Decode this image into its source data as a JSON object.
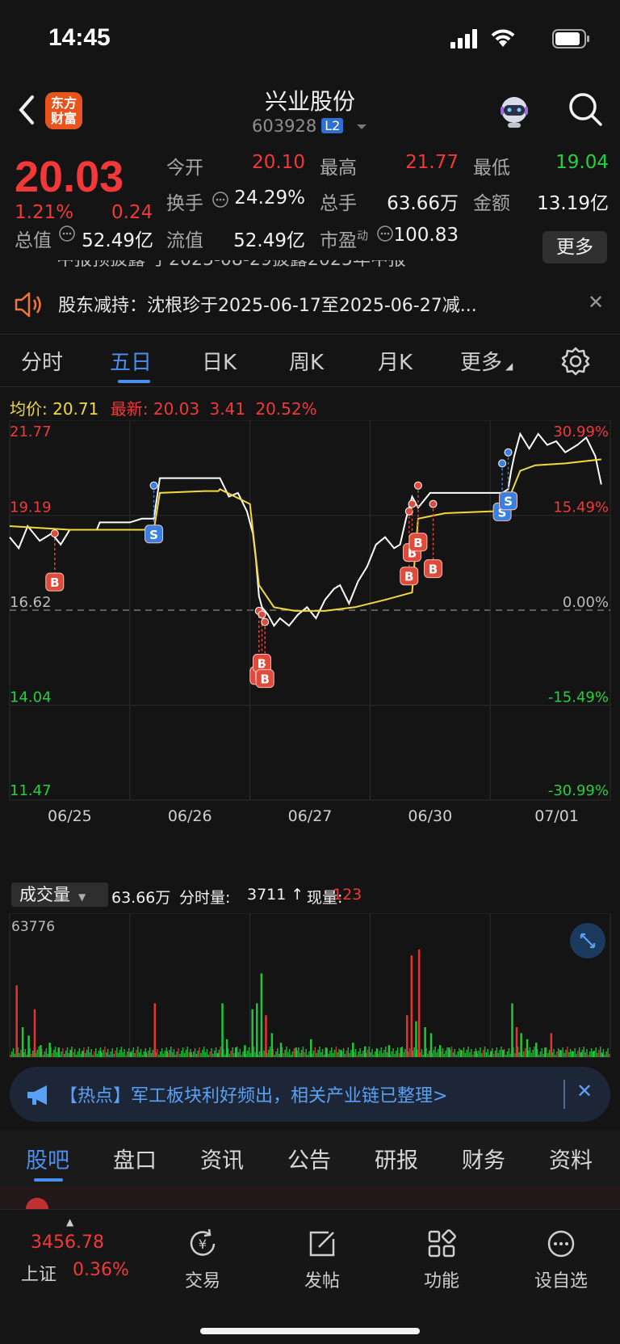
{
  "status_bar": {
    "time": "14:45"
  },
  "header": {
    "title": "兴业股份",
    "code": "603928",
    "level_badge": "L2",
    "logo_text_line1": "东方",
    "logo_text_line2": "财富"
  },
  "quote": {
    "price": "20.03",
    "change_pct": "1.21%",
    "change": "0.24",
    "fields": [
      {
        "label": "今开",
        "value": "20.10",
        "color": "#f23838"
      },
      {
        "label": "最高",
        "value": "21.77",
        "color": "#f23838"
      },
      {
        "label": "最低",
        "value": "19.04",
        "color": "#22d23c"
      },
      {
        "label": "换手",
        "value": "24.29%",
        "color": "#f2f2f2"
      },
      {
        "label": "总手",
        "value": "63.66万",
        "color": "#f2f2f2"
      },
      {
        "label": "金额",
        "value": "13.19亿",
        "color": "#f2f2f2"
      },
      {
        "label": "总值",
        "value": "52.49亿",
        "color": "#f2f2f2"
      },
      {
        "label": "流值",
        "value": "52.49亿",
        "color": "#f2f2f2"
      },
      {
        "label": "市盈",
        "value": "100.83",
        "color": "#f2f2f2"
      }
    ],
    "pe_superscript": "动",
    "more_label": "更多"
  },
  "notice": {
    "partial_text": "中报预披露 于2025-08-29披露2025年中报",
    "text": "股东减持：沈根珍于2025-06-17至2025-06-27减..."
  },
  "chart_tabs": [
    {
      "label": "分时",
      "active": false
    },
    {
      "label": "五日",
      "active": true
    },
    {
      "label": "日K",
      "active": false
    },
    {
      "label": "周K",
      "active": false
    },
    {
      "label": "月K",
      "active": false
    },
    {
      "label": "更多",
      "active": false
    }
  ],
  "legend": {
    "avg_label": "均价:",
    "avg_value": "20.71",
    "latest_label": "最新:",
    "latest_value": "20.03",
    "latest_change": "3.41",
    "latest_pct": "20.52%"
  },
  "chart_data": {
    "type": "line",
    "title": "",
    "y_left_ticks": [
      "21.77",
      "19.19",
      "16.62",
      "14.04",
      "11.47"
    ],
    "y_right_ticks": [
      "30.99%",
      "15.49%",
      "0.00%",
      "-15.49%",
      "-30.99%"
    ],
    "x_ticks": [
      "06/25",
      "06/26",
      "06/27",
      "06/30",
      "07/01"
    ],
    "ylim": [
      11.47,
      21.77
    ],
    "prev_close": 16.62,
    "series": [
      {
        "color": "#ffffff",
        "points": [
          [
            0,
            18.6
          ],
          [
            0.3,
            18.3
          ],
          [
            0.6,
            18.9
          ],
          [
            1.0,
            18.5
          ],
          [
            1.4,
            18.7
          ],
          [
            1.7,
            18.4
          ],
          [
            2.0,
            18.8
          ],
          [
            2.4,
            18.8
          ],
          [
            2.9,
            18.8
          ],
          [
            3.0,
            19.0
          ],
          [
            3.5,
            19.0
          ],
          [
            4.0,
            19.0
          ],
          [
            4.4,
            19.1
          ],
          [
            4.8,
            19.1
          ],
          [
            5.0,
            20.2
          ],
          [
            5.5,
            20.2
          ],
          [
            6.0,
            20.2
          ],
          [
            6.5,
            20.2
          ],
          [
            6.95,
            20.2
          ],
          [
            7.0,
            20.2
          ],
          [
            7.3,
            19.7
          ],
          [
            7.6,
            19.8
          ],
          [
            7.9,
            19.3
          ],
          [
            8.1,
            18.7
          ],
          [
            8.2,
            18.0
          ],
          [
            8.3,
            17.0
          ],
          [
            8.4,
            16.7
          ],
          [
            8.6,
            16.5
          ],
          [
            8.8,
            16.2
          ],
          [
            9.0,
            16.4
          ],
          [
            9.3,
            16.2
          ],
          [
            9.6,
            16.5
          ],
          [
            9.9,
            16.7
          ],
          [
            10.2,
            16.4
          ],
          [
            10.5,
            16.9
          ],
          [
            10.8,
            17.2
          ],
          [
            11.0,
            17.3
          ],
          [
            11.3,
            16.8
          ],
          [
            11.6,
            17.4
          ],
          [
            11.9,
            17.8
          ],
          [
            12.2,
            18.4
          ],
          [
            12.5,
            18.6
          ],
          [
            12.8,
            18.3
          ],
          [
            13.0,
            18.4
          ],
          [
            13.2,
            19.1
          ],
          [
            13.4,
            19.7
          ],
          [
            13.6,
            19.4
          ],
          [
            13.8,
            19.6
          ],
          [
            14.0,
            19.8
          ],
          [
            14.5,
            19.8
          ],
          [
            15.0,
            19.8
          ],
          [
            15.5,
            19.8
          ],
          [
            16.0,
            19.8
          ],
          [
            16.4,
            19.8
          ],
          [
            16.6,
            19.9
          ],
          [
            16.7,
            20.4
          ],
          [
            16.8,
            20.8
          ],
          [
            17.0,
            21.4
          ],
          [
            17.3,
            21.0
          ],
          [
            17.6,
            21.4
          ],
          [
            17.9,
            21.1
          ],
          [
            18.2,
            21.2
          ],
          [
            18.5,
            20.9
          ],
          [
            18.9,
            21.1
          ],
          [
            19.2,
            21.3
          ],
          [
            19.5,
            20.8
          ],
          [
            19.7,
            20.03
          ]
        ]
      },
      {
        "color": "#f2d93b",
        "points": [
          [
            0,
            18.9
          ],
          [
            2.0,
            18.8
          ],
          [
            4.8,
            18.8
          ],
          [
            5.0,
            19.8
          ],
          [
            6.5,
            19.85
          ],
          [
            6.95,
            19.85
          ],
          [
            7.0,
            19.9
          ],
          [
            8.0,
            19.5
          ],
          [
            8.3,
            17.3
          ],
          [
            8.8,
            16.7
          ],
          [
            9.5,
            16.6
          ],
          [
            10.5,
            16.6
          ],
          [
            11.5,
            16.7
          ],
          [
            12.5,
            16.9
          ],
          [
            13.4,
            17.1
          ],
          [
            13.6,
            19.1
          ],
          [
            14.5,
            19.25
          ],
          [
            16.0,
            19.3
          ],
          [
            16.6,
            19.3
          ],
          [
            16.7,
            19.8
          ],
          [
            17.0,
            20.4
          ],
          [
            17.5,
            20.55
          ],
          [
            18.5,
            20.6
          ],
          [
            19.7,
            20.71
          ]
        ]
      }
    ],
    "trade_markers": [
      {
        "type": "B",
        "x": 1.5,
        "price": 18.7
      },
      {
        "type": "S",
        "x": 4.8,
        "price": 20.0
      },
      {
        "type": "B",
        "x": 8.3,
        "price": 16.6
      },
      {
        "type": "B",
        "x": 8.4,
        "price": 16.5
      },
      {
        "type": "B",
        "x": 8.5,
        "price": 16.3
      },
      {
        "type": "B",
        "x": 13.3,
        "price": 19.3
      },
      {
        "type": "B",
        "x": 13.4,
        "price": 19.5
      },
      {
        "type": "B",
        "x": 13.6,
        "price": 20.0
      },
      {
        "type": "B",
        "x": 14.1,
        "price": 19.5
      },
      {
        "type": "S",
        "x": 16.4,
        "price": 20.6
      },
      {
        "type": "S",
        "x": 16.6,
        "price": 20.9
      }
    ]
  },
  "volume": {
    "select_label": "成交量",
    "total": "63.66万",
    "minute_label": "分时量:",
    "minute_value": "3711 ↑",
    "current_label": "现量:",
    "current_value": "123",
    "max_label": "63776",
    "bars": [
      [
        0.2,
        60,
        "r"
      ],
      [
        0.4,
        25,
        "g"
      ],
      [
        0.6,
        18,
        "g"
      ],
      [
        0.8,
        40,
        "r"
      ],
      [
        1.0,
        10,
        "g"
      ],
      [
        1.3,
        12,
        "g"
      ],
      [
        1.6,
        8,
        "g"
      ],
      [
        2.0,
        6,
        "g"
      ],
      [
        2.4,
        5,
        "g"
      ],
      [
        3.0,
        5,
        "g"
      ],
      [
        4.0,
        4,
        "g"
      ],
      [
        4.5,
        4,
        "g"
      ],
      [
        4.8,
        45,
        "r"
      ],
      [
        5.2,
        5,
        "g"
      ],
      [
        6.0,
        4,
        "g"
      ],
      [
        6.9,
        3,
        "g"
      ],
      [
        7.05,
        45,
        "g"
      ],
      [
        7.2,
        15,
        "g"
      ],
      [
        7.5,
        8,
        "g"
      ],
      [
        7.8,
        10,
        "g"
      ],
      [
        8.05,
        40,
        "g"
      ],
      [
        8.2,
        45,
        "g"
      ],
      [
        8.35,
        70,
        "g"
      ],
      [
        8.5,
        35,
        "r"
      ],
      [
        8.7,
        20,
        "g"
      ],
      [
        9.0,
        12,
        "g"
      ],
      [
        9.5,
        8,
        "g"
      ],
      [
        10.0,
        15,
        "g"
      ],
      [
        10.5,
        8,
        "g"
      ],
      [
        11.0,
        6,
        "g"
      ],
      [
        11.4,
        12,
        "g"
      ],
      [
        11.8,
        9,
        "g"
      ],
      [
        12.2,
        7,
        "g"
      ],
      [
        12.6,
        10,
        "g"
      ],
      [
        13.0,
        8,
        "g"
      ],
      [
        13.2,
        35,
        "r"
      ],
      [
        13.35,
        85,
        "r"
      ],
      [
        13.5,
        30,
        "g"
      ],
      [
        13.6,
        90,
        "r"
      ],
      [
        13.8,
        25,
        "g"
      ],
      [
        14.0,
        20,
        "g"
      ],
      [
        14.3,
        10,
        "g"
      ],
      [
        14.6,
        8,
        "g"
      ],
      [
        15.0,
        6,
        "g"
      ],
      [
        15.5,
        5,
        "g"
      ],
      [
        16.0,
        5,
        "g"
      ],
      [
        16.4,
        6,
        "g"
      ],
      [
        16.7,
        45,
        "g"
      ],
      [
        16.85,
        25,
        "r"
      ],
      [
        17.0,
        20,
        "g"
      ],
      [
        17.2,
        15,
        "g"
      ],
      [
        17.5,
        12,
        "g"
      ],
      [
        17.8,
        8,
        "g"
      ],
      [
        18.0,
        20,
        "r"
      ],
      [
        18.3,
        6,
        "g"
      ],
      [
        18.7,
        5,
        "g"
      ],
      [
        19.0,
        4,
        "g"
      ],
      [
        19.4,
        5,
        "g"
      ],
      [
        19.7,
        3,
        "g"
      ]
    ]
  },
  "hot_banner": {
    "text": "【热点】军工板块利好频出，相关产业链已整理>"
  },
  "info_tabs": [
    {
      "label": "股吧",
      "active": true
    },
    {
      "label": "盘口",
      "active": false
    },
    {
      "label": "资讯",
      "active": false
    },
    {
      "label": "公告",
      "active": false
    },
    {
      "label": "研报",
      "active": false
    },
    {
      "label": "财务",
      "active": false
    },
    {
      "label": "资料",
      "active": false
    }
  ],
  "bottom_nav": {
    "index_value": "3456.78",
    "index_name": "上证",
    "index_pct": "0.36%",
    "items": [
      {
        "label": "交易",
        "icon": "yen-refresh-icon"
      },
      {
        "label": "发帖",
        "icon": "edit-icon"
      },
      {
        "label": "功能",
        "icon": "grid-icon"
      },
      {
        "label": "设自选",
        "icon": "more-icon"
      }
    ]
  }
}
